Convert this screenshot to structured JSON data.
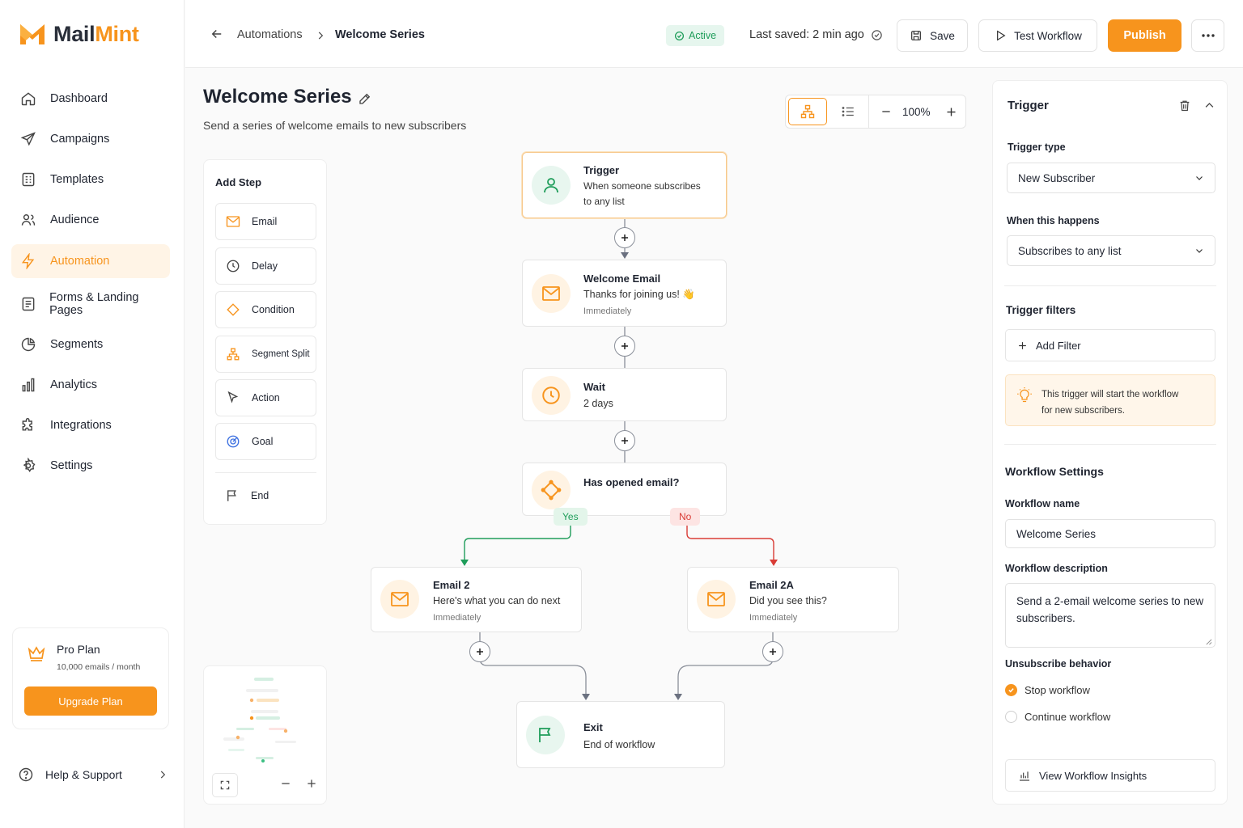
{
  "brand": {
    "name_part1": "Mail",
    "name_part2": "Mint",
    "accent": "#f7941d"
  },
  "sidebar": {
    "items": [
      {
        "label": "Dashboard",
        "icon": "home-icon"
      },
      {
        "label": "Campaigns",
        "icon": "send-icon"
      },
      {
        "label": "Templates",
        "icon": "template-icon"
      },
      {
        "label": "Audience",
        "icon": "users-icon"
      },
      {
        "label": "Automation",
        "icon": "bolt-icon",
        "active": true
      },
      {
        "label": "Forms & Landing Pages",
        "icon": "form-icon"
      },
      {
        "label": "Segments",
        "icon": "pie-icon"
      },
      {
        "label": "Analytics",
        "icon": "bar-chart-icon"
      },
      {
        "label": "Integrations",
        "icon": "puzzle-icon"
      },
      {
        "label": "Settings",
        "icon": "gear-icon"
      }
    ],
    "plan": {
      "title": "Pro Plan",
      "subtitle": "10,000 emails / month",
      "button": "Upgrade Plan"
    },
    "help": "Help & Support"
  },
  "topbar": {
    "breadcrumb_parent": "Automations",
    "breadcrumb_current": "Welcome Series",
    "status": "Active",
    "last_saved": "Last saved: 2 min ago",
    "save": "Save",
    "test": "Test Workflow",
    "publish": "Publish"
  },
  "page": {
    "title": "Welcome Series",
    "subtitle": "Send a series of welcome emails to new subscribers",
    "zoom": "100%"
  },
  "add_step": {
    "title": "Add Step",
    "items": [
      "Email",
      "Delay",
      "Condition",
      "Segment Split",
      "Action",
      "Goal",
      "End"
    ]
  },
  "workflow": {
    "trigger": {
      "title": "Trigger",
      "desc_line1": "When someone subscribes",
      "desc_line2": "to any list"
    },
    "welcome_email": {
      "title": "Welcome Email",
      "desc": "Thanks for joining us! 👋",
      "meta": "Immediately"
    },
    "wait": {
      "title": "Wait",
      "desc": "2 days"
    },
    "condition": {
      "title": "Has opened email?",
      "yes": "Yes",
      "no": "No"
    },
    "email2": {
      "title": "Email 2",
      "desc": "Here's what you can do next",
      "meta": "Immediately"
    },
    "email2a": {
      "title": "Email 2A",
      "desc": "Did you see this?",
      "meta": "Immediately"
    },
    "exit": {
      "title": "Exit",
      "desc": "End of workflow"
    }
  },
  "panel": {
    "title": "Trigger",
    "trigger_type_label": "Trigger type",
    "trigger_type_value": "New Subscriber",
    "when_label": "When this happens",
    "when_value": "Subscribes to any list",
    "filters_title": "Trigger filters",
    "add_filter": "Add Filter",
    "note_line1": "This trigger will start the workflow",
    "note_line2": "for new subscribers.",
    "settings_title": "Workflow Settings",
    "name_label": "Workflow name",
    "name_value": "Welcome Series",
    "desc_label": "Workflow description",
    "desc_value": "Send a 2-email welcome series to new subscribers.",
    "unsub_label": "Unsubscribe behavior",
    "radio_stop": "Stop workflow",
    "radio_continue": "Continue workflow",
    "insights": "View Workflow Insights"
  }
}
